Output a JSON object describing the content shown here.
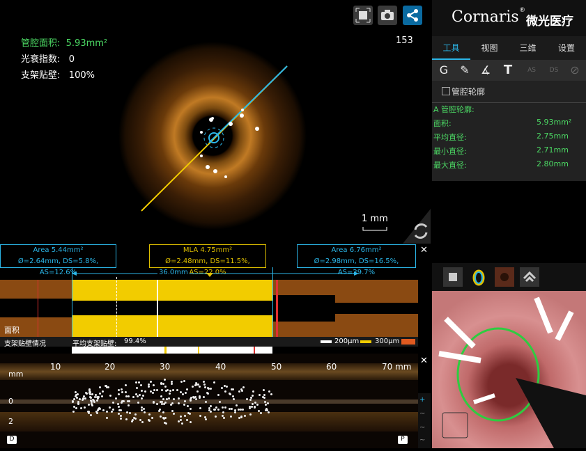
{
  "brand": {
    "logo_text": "Cornaris",
    "registered": "®",
    "name_cn": "微光医疗"
  },
  "main_view": {
    "metrics": [
      {
        "label": "管腔面积:",
        "value": "5.93mm²"
      },
      {
        "label": "光衰指数:",
        "value": "0"
      },
      {
        "label": "支架贴壁:",
        "value": "100%"
      }
    ],
    "frame_number": "153",
    "scale_bar": "1 mm"
  },
  "tabs": [
    "工具",
    "视图",
    "三维",
    "设置"
  ],
  "tools": {
    "text_tool": "T",
    "as_label": "AS",
    "ds_label": "DS"
  },
  "info": {
    "checkbox_label": "管腔轮廓",
    "header": "A 管腔轮廓:",
    "rows": [
      {
        "label": "面积:",
        "value": "5.93mm²"
      },
      {
        "label": "平均直径:",
        "value": "2.75mm"
      },
      {
        "label": "最小直径:",
        "value": "2.71mm"
      },
      {
        "label": "最大直径:",
        "value": "2.80mm"
      }
    ]
  },
  "annotations": {
    "left": {
      "title": "Area 5.44mm²",
      "detail": "Ø=2.64mm, DS=5.8%, AS=12.6%"
    },
    "mla": {
      "title": "MLA 4.75mm²",
      "detail": "Ø=2.48mm, DS=11.5%, AS=22.0%"
    },
    "right": {
      "title": "Area 6.76mm²",
      "detail": "Ø=2.98mm, DS=16.5%, AS=29.7%"
    },
    "length": "36.0mm"
  },
  "lumen_chart": {
    "label": "面积"
  },
  "apposition": {
    "label": "支架贴壁情况",
    "avg_label": "平均支架贴壁:",
    "avg_value": "99.4%",
    "legend_200": "200μm",
    "legend_300": "300μm"
  },
  "long_view": {
    "x_axis": [
      "10",
      "20",
      "30",
      "40",
      "50",
      "60",
      "70 mm"
    ],
    "y_unit": "mm",
    "y_axis": [
      "0",
      "2"
    ],
    "d_marker": "D",
    "p_marker": "P"
  },
  "close_icon": "✕",
  "colors": {
    "accent_blue": "#2bb6e8",
    "green": "#4cd964",
    "yellow": "#f2cc00",
    "lumen_brown": "#8a4a12"
  }
}
